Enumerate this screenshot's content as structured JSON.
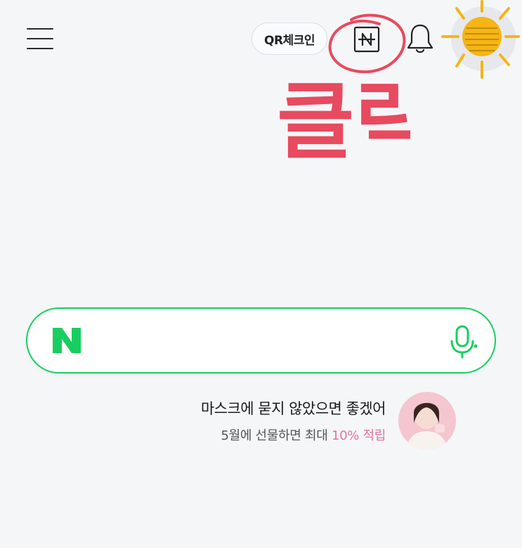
{
  "header": {
    "menu_icon": "hamburger-menu-icon",
    "qr_checkin_label": "QR체크인",
    "npay_icon": "naver-pay-icon",
    "notification_icon": "bell-icon"
  },
  "annotations": {
    "handwritten_text": "클릭",
    "circle_color": "#e84a5f",
    "sun_color": "#f5b515"
  },
  "search": {
    "logo_letter": "N",
    "placeholder": "",
    "value": "",
    "mic_icon": "microphone-icon",
    "accent_color": "#19ce60"
  },
  "ad": {
    "headline": "마스크에 묻지 않았으면 좋겠어",
    "subline_prefix": "5월에 선물하면 최대 ",
    "subline_highlight": "10% 적립",
    "highlight_color": "#e6739c"
  }
}
